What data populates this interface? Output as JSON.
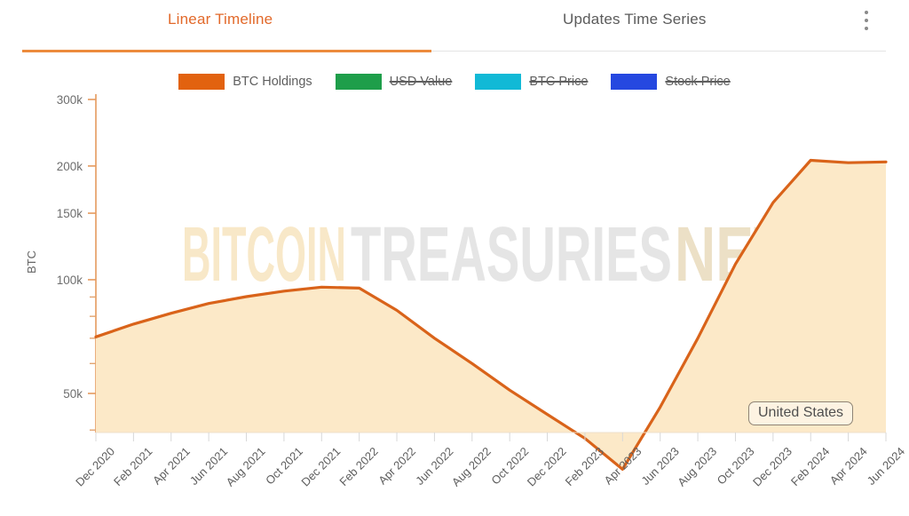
{
  "tabs": [
    {
      "label": "Linear Timeline",
      "active": true
    },
    {
      "label": "Updates Time Series",
      "active": false
    }
  ],
  "overflow_menu": {
    "icon": "kebab-menu-icon"
  },
  "legend": {
    "items": [
      {
        "label": "BTC Holdings",
        "color": "#e2620f",
        "enabled": true
      },
      {
        "label": "USD Value",
        "color": "#1e9e4a",
        "enabled": false
      },
      {
        "label": "BTC Price",
        "color": "#11b9d6",
        "enabled": false
      },
      {
        "label": "Stock Price",
        "color": "#2548e0",
        "enabled": false
      }
    ]
  },
  "watermark": {
    "part1": "BITCOIN",
    "part2": "TREASURIES",
    "part3": "NET"
  },
  "country_badge": {
    "label": "United States"
  },
  "chart_data": {
    "type": "area",
    "title": "",
    "xlabel": "",
    "ylabel": "BTC",
    "yscale": "log",
    "ylim": [
      28000,
      330000
    ],
    "grid": false,
    "legend_position": "top",
    "y_tick_labels": [
      "300k",
      "200k",
      "150k",
      "100k",
      "50k"
    ],
    "y_tick_values": [
      300000,
      200000,
      150000,
      100000,
      50000
    ],
    "y_minor_tick_values": [
      90000,
      80000,
      70000,
      60000,
      40000,
      30000
    ],
    "categories": [
      "Dec 2020",
      "Feb 2021",
      "Apr 2021",
      "Jun 2021",
      "Aug 2021",
      "Oct 2021",
      "Dec 2021",
      "Feb 2022",
      "Apr 2022",
      "Jun 2022",
      "Aug 2022",
      "Oct 2022",
      "Dec 2022",
      "Feb 2023",
      "Apr 2023",
      "Jun 2023",
      "Aug 2023",
      "Oct 2023",
      "Dec 2023",
      "Feb 2024",
      "Apr 2024",
      "Jun 2024"
    ],
    "series": [
      {
        "name": "BTC Holdings",
        "color": "#d9631a",
        "fill": "#fce9c8",
        "values": [
          70600,
          76300,
          81500,
          86500,
          90200,
          93300,
          95600,
          95000,
          83000,
          70000,
          60000,
          51000,
          44000,
          38000,
          31500,
          46000,
          70000,
          110000,
          160000,
          207000,
          204000,
          205000
        ]
      }
    ]
  }
}
